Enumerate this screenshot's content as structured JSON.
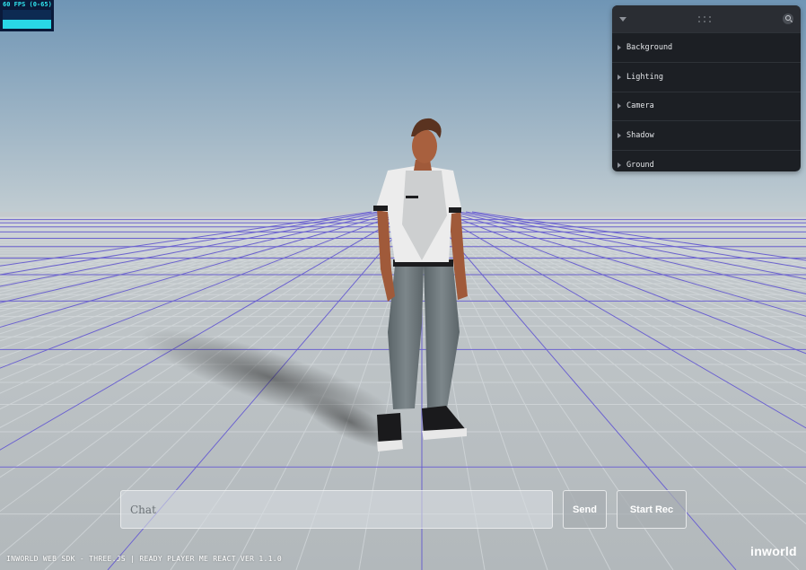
{
  "fps": {
    "label": "60 FPS (0-65)",
    "level": 0.48
  },
  "panel": {
    "folders": [
      {
        "label": "Background"
      },
      {
        "label": "Lighting"
      },
      {
        "label": "Camera"
      },
      {
        "label": "Shadow"
      },
      {
        "label": "Ground"
      }
    ]
  },
  "chat": {
    "placeholder": "Chat",
    "value": ""
  },
  "buttons": {
    "send": "Send",
    "start_rec": "Start Rec"
  },
  "footer": {
    "sdk_text": "INWORLD WEB SDK - THREE.JS | READY PLAYER ME REACT VER 1.1.0"
  },
  "logo": {
    "text": "inworld"
  },
  "colors": {
    "sky_top": "#6f95b5",
    "sky_horizon": "#c2cdd2",
    "floor": "#b9bfc2",
    "grid_line": "#4a3ccc"
  },
  "icons": [
    "chevron-down-icon",
    "drag-handle-icon",
    "search-icon",
    "caret-right-icon"
  ]
}
